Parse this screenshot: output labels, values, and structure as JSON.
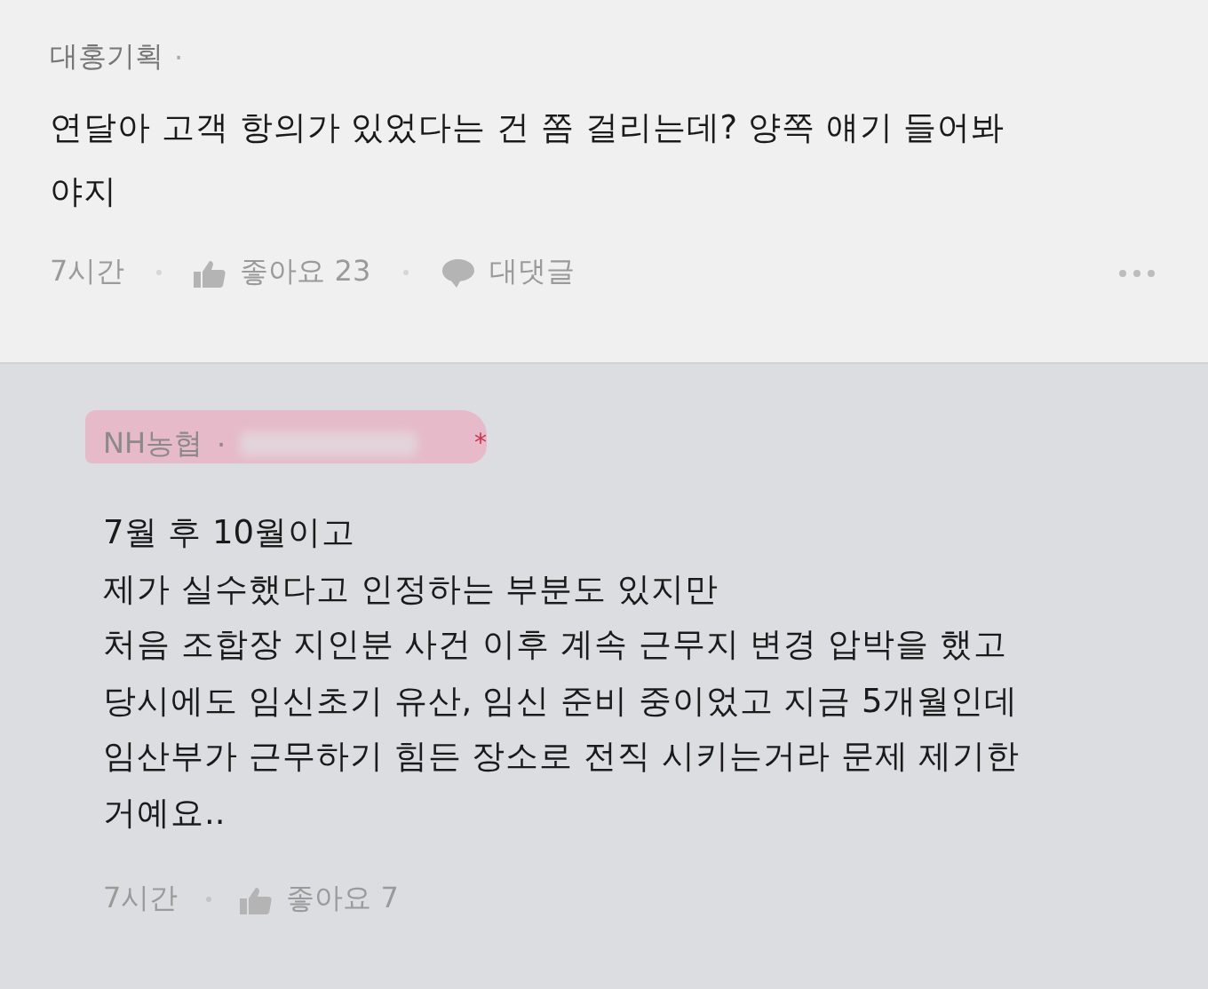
{
  "comment": {
    "author": "대홍기획",
    "separator": "·",
    "text": "연달아 고객 항의가 있었다는 건 쫌 걸리는데? 양쪽 얘기 들어봐\n야지",
    "time": "7시간",
    "like_label": "좋아요 23",
    "reply_label": "대댓글"
  },
  "reply": {
    "author": "NH농협",
    "separator": "·",
    "asterisk": "*",
    "text": "7월 후 10월이고\n제가 실수했다고 인정하는 부분도 있지만\n처음 조합장 지인분 사건 이후 계속 근무지 변경 압박을 했고\n당시에도 임신초기 유산, 임신 준비 중이었고 지금 5개월인데\n임산부가 근무하기 힘든 장소로 전직 시키는거라 문제 제기한\n거예요..",
    "time": "7시간",
    "like_label": "좋아요 7"
  }
}
